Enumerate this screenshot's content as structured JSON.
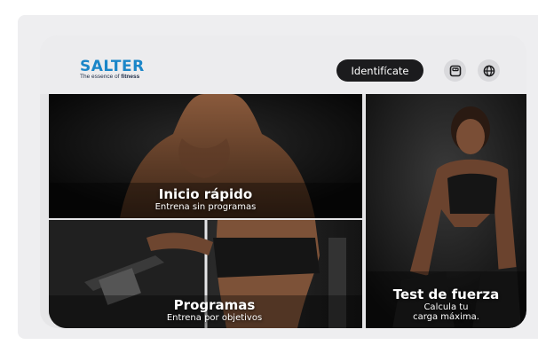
{
  "brand": {
    "name": "SALTER",
    "tagline_prefix": "The essence of",
    "tagline_bold": "fitness",
    "color": "#1b86c8"
  },
  "header": {
    "login_label": "Identifícate",
    "icons": [
      "scale-icon",
      "globe-icon"
    ]
  },
  "tiles": {
    "quick_start": {
      "title": "Inicio rápido",
      "subtitle": "Entrena sin programas"
    },
    "programs": {
      "title": "Programas",
      "subtitle": "Entrena por objetivos"
    },
    "strength_test": {
      "title": "Test de fuerza",
      "subtitle_line1": "Calcula tu",
      "subtitle_line2": "carga máxima."
    }
  }
}
